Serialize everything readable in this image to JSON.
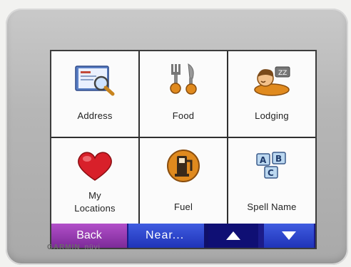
{
  "device": {
    "brand": "GARMIN",
    "model": "nüvi"
  },
  "menu": {
    "tiles": [
      {
        "label": "Address",
        "icon": "address-book-icon"
      },
      {
        "label": "Food",
        "icon": "fork-knife-icon"
      },
      {
        "label": "Lodging",
        "icon": "sleeping-person-icon"
      },
      {
        "label": "My\nLocations",
        "icon": "heart-icon"
      },
      {
        "label": "Fuel",
        "icon": "fuel-pump-icon"
      },
      {
        "label": "Spell Name",
        "icon": "letter-blocks-icon"
      }
    ]
  },
  "toolbar": {
    "back_label": "Back",
    "near_label": "Near...",
    "up_icon": "up-arrow-icon",
    "down_icon": "down-arrow-icon"
  },
  "colors": {
    "toolbar_blue": "#1b1b8a",
    "back_purple": "#9a3db5",
    "heart_red": "#d8202a",
    "icon_orange": "#e08a1e"
  }
}
